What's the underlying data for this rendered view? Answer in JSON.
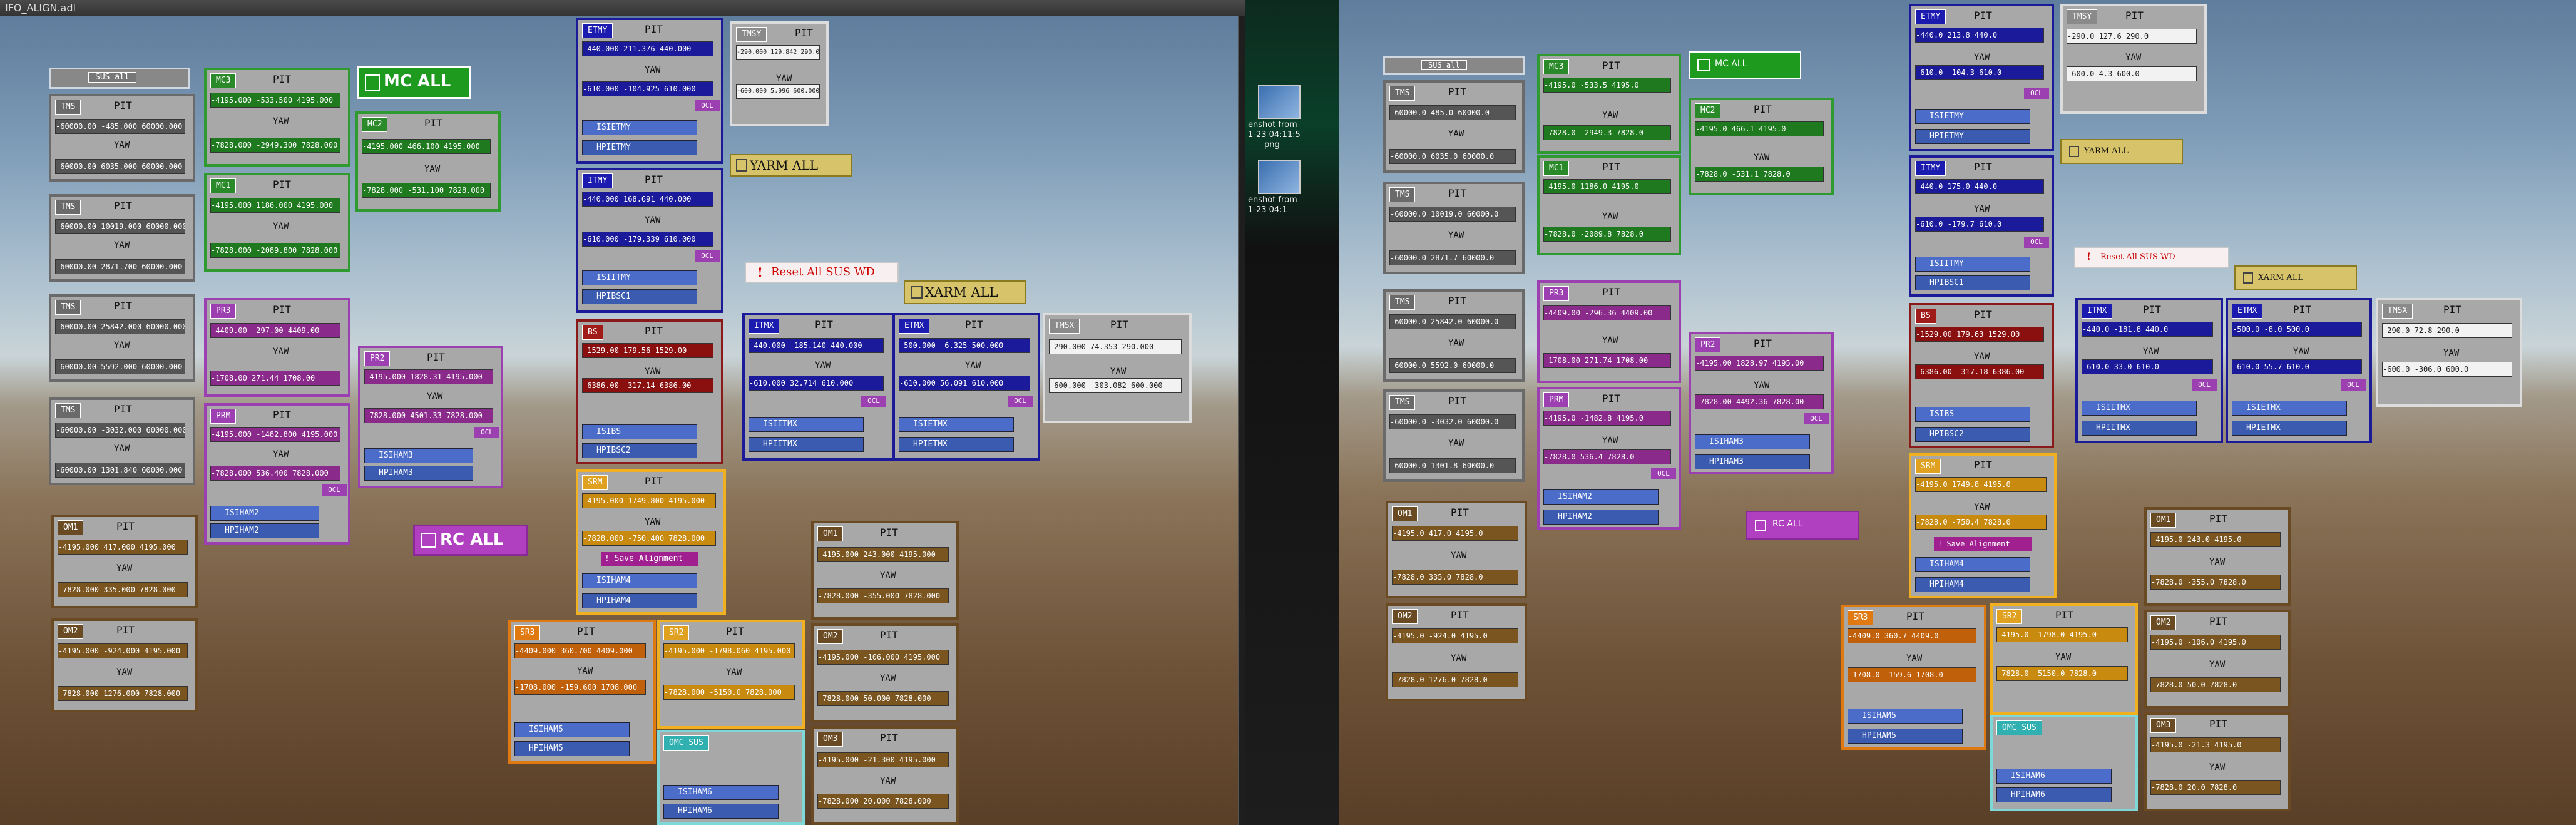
{
  "left": {
    "window_title": "IFO_ALIGN.adl",
    "sus_all": "SUS all",
    "mc_all": "MC ALL",
    "rc_all": "RC ALL",
    "yarm_all": "YARM ALL",
    "xarm_all": "XARM ALL",
    "reset_wd": "Reset All SUS WD",
    "save_alignment": "Save Alignment",
    "pit": "PIT",
    "yaw": "YAW",
    "panels": {
      "tms_top": {
        "tag": "TMS",
        "row1": "-60000.00 -485.000 60000.000",
        "row2": "-60000.00 6035.000 60000.000"
      },
      "tms_2": {
        "tag": "TMS",
        "row1": "-60000.00 10019.000 60000.000",
        "row2": "-60000.00 2871.700 60000.000"
      },
      "tms_3": {
        "tag": "TMS",
        "row1": "-60000.00 25842.000 60000.000",
        "row2": "-60000.00 5592.000 60000.000"
      },
      "tms_4": {
        "tag": "TMS",
        "row1": "-60000.00 -3032.000 60000.000",
        "row2": "-60000.00 1301.840 60000.000"
      },
      "om1": {
        "tag": "OM1",
        "row1": "-4195.000 417.000 4195.000",
        "row2": "-7828.000 335.000 7828.000"
      },
      "om2": {
        "tag": "OM2",
        "row1": "-4195.000 -924.000 4195.000",
        "row2": "-7828.000 1276.000 7828.000"
      },
      "mc3": {
        "tag": "MC3",
        "row1": "-4195.000 -533.500 4195.000",
        "row2": "-7828.000 -2949.300 7828.000"
      },
      "mc1": {
        "tag": "MC1",
        "row1": "-4195.000 1186.000 4195.000",
        "row2": "-7828.000 -2089.800 7828.000"
      },
      "mc2": {
        "tag": "MC2",
        "row1": "-4195.000 466.100 4195.000",
        "row2": "-7828.000 -531.100 7828.000"
      },
      "pr3": {
        "tag": "PR3",
        "row1": "-4409.00 -297.00 4409.00",
        "row2": "-1708.00 271.44 1708.00"
      },
      "prm": {
        "tag": "PRM",
        "row1": "-4195.000 -1482.800 4195.000",
        "row2": "-7828.000 536.400 7828.000"
      },
      "pr2": {
        "tag": "PR2",
        "row1": "-4195.000 1828.31 4195.000",
        "row2": "-7828.000 4501.33 7828.000"
      },
      "etmy": {
        "tag": "ETMY",
        "row1": "-440.000 211.376 440.000",
        "row2": "-610.000 -104.925 610.000"
      },
      "itmy": {
        "tag": "ITMY",
        "row1": "-440.000 168.691 440.000",
        "row2": "-610.000 -179.339 610.000"
      },
      "bs": {
        "tag": "BS",
        "row1": "-1529.00 179.56 1529.00",
        "row2": "-6386.00 -317.14 6386.00"
      },
      "tmsy": {
        "tag": "TMSY",
        "row1": "-290.000 129.842 290.000",
        "row2": "-600.000 5.996 600.000"
      },
      "itmx": {
        "tag": "ITMX",
        "row1": "-440.000 -185.140 440.000",
        "row2": "-610.000 32.714 610.000"
      },
      "etmx": {
        "tag": "ETMX",
        "row1": "-500.000 -6.325 500.000",
        "row2": "-610.000 56.091 610.000"
      },
      "tmsx": {
        "tag": "TMSX",
        "row1": "-290.000 74.353 290.000",
        "row2": "-600.000 -303.082 600.000"
      },
      "srm": {
        "tag": "SRM",
        "row1": "-4195.000 1749.800 4195.000",
        "row2": "-7828.000 -750.400 7828.000"
      },
      "sr3": {
        "tag": "SR3",
        "row1": "-4409.000 360.700 4409.000",
        "row2": "-1708.000 -159.600 1708.000"
      },
      "sr2": {
        "tag": "SR2",
        "row1": "-4195.000 -1798.060 4195.000",
        "row2": "-7828.000 -5150.0 7828.000"
      },
      "om1r": {
        "tag": "OM1",
        "row1": "-4195.000 243.000 4195.000",
        "row2": "-7828.000 -355.000 7828.000"
      },
      "om2r": {
        "tag": "OM2",
        "row1": "-4195.000 -106.000 4195.000",
        "row2": "-7828.000 50.000 7828.000"
      },
      "om3": {
        "tag": "OM3",
        "row1": "-4195.000 -21.300 4195.000",
        "row2": "-7828.000 20.000 7828.000"
      },
      "omc_sus": {
        "tag": "OMC SUS"
      }
    },
    "buttons": {
      "isi_etmy": "ISIETMY",
      "hpi_etmy": "HPIETMY",
      "isi_itmy": "ISIITMY",
      "hpi_bsc1": "HPIBSC1",
      "isi_bs": "ISIBS",
      "hpi_bsc2": "HPIBSC2",
      "isi_itmx": "ISIITMX",
      "hpi_itmx": "HPIITMX",
      "isi_etmx": "ISIETMX",
      "hpi_etmx": "HPIETMX",
      "isi_ham2": "ISIHAM2",
      "hpi_ham2": "HPIHAM2",
      "isi_ham3": "ISIHAM3",
      "hpi_ham3": "HPIHAM3",
      "isi_ham4": "ISIHAM4",
      "hpi_ham4": "HPIHAM4",
      "isi_ham5": "ISIHAM5",
      "hpi_ham5": "HPIHAM5",
      "isi_ham6": "ISIHAM6",
      "hpi_ham6": "HPIHAM6",
      "ocl": "OCL"
    }
  },
  "middle": {
    "icon1_label": "enshot from",
    "icon1_sub": "1-23 04:11:5",
    "icon1_ext": "png",
    "icon2_label": "enshot from",
    "icon2_sub": "1-23 04:1"
  },
  "right": {
    "sus_all": "SUS all",
    "mc_all": "MC ALL",
    "rc_all": "RC ALL",
    "yarm_all": "YARM ALL",
    "xarm_all": "XARM ALL",
    "reset_wd": "Reset All SUS WD",
    "save_alignment": "Save Alignment",
    "pit": "PIT",
    "yaw": "YAW",
    "panels": {
      "tms1": {
        "tag": "TMS",
        "row1": "-60000.0 485.0 60000.0",
        "row2": "-60000.0 6035.0 60000.0"
      },
      "tms2": {
        "tag": "TMS",
        "row1": "-60000.0 10019.0 60000.0",
        "row2": "-60000.0 2871.7 60000.0"
      },
      "tms3": {
        "tag": "TMS",
        "row1": "-60000.0 25842.0 60000.0",
        "row2": "-60000.0 5592.0 60000.0"
      },
      "tms4": {
        "tag": "TMS",
        "row1": "-60000.0 -3032.0 60000.0",
        "row2": "-60000.0 1301.8 60000.0"
      },
      "om1": {
        "tag": "OM1",
        "row1": "-4195.0 417.0 4195.0",
        "row2": "-7828.0 335.0 7828.0"
      },
      "om2": {
        "tag": "OM2",
        "row1": "-4195.0 -924.0 4195.0",
        "row2": "-7828.0 1276.0 7828.0"
      },
      "mc3": {
        "tag": "MC3",
        "row1": "-4195.0 -533.5 4195.0",
        "row2": "-7828.0 -2949.3 7828.0"
      },
      "mc1": {
        "tag": "MC1",
        "row1": "-4195.0 1186.0 4195.0",
        "row2": "-7828.0 -2089.8 7828.0"
      },
      "mc2": {
        "tag": "MC2",
        "row1": "-4195.0 466.1 4195.0",
        "row2": "-7828.0 -531.1 7828.0"
      },
      "pr3": {
        "tag": "PR3",
        "row1": "-4409.00 -296.36 4409.00",
        "row2": "-1708.00 271.74 1708.00"
      },
      "prm": {
        "tag": "PRM",
        "row1": "-4195.0 -1482.8 4195.0",
        "row2": "-7828.0 536.4 7828.0"
      },
      "pr2": {
        "tag": "PR2",
        "row1": "-4195.00 1828.97 4195.00",
        "row2": "-7828.00 4492.36 7828.00"
      },
      "etmy": {
        "tag": "ETMY",
        "row1": "-440.0 213.8 440.0",
        "row2": "-610.0 -104.3 610.0"
      },
      "itmy": {
        "tag": "ITMY",
        "row1": "-440.0 175.0 440.0",
        "row2": "-610.0 -179.7 610.0"
      },
      "bs": {
        "tag": "BS",
        "row1": "-1529.00 179.63 1529.00",
        "row2": "-6386.00 -317.18 6386.00"
      },
      "tmsy": {
        "tag": "TMSY",
        "row1": "-290.0 127.6 290.0",
        "row2": "-600.0 4.3 600.0"
      },
      "itmx": {
        "tag": "ITMX",
        "row1": "-440.0 -181.8 440.0",
        "row2": "-610.0 33.0 610.0"
      },
      "etmx": {
        "tag": "ETMX",
        "row1": "-500.0 -8.0 500.0",
        "row2": "-610.0 55.7 610.0"
      },
      "tmsx": {
        "tag": "TMSX",
        "row1": "-290.0 72.8 290.0",
        "row2": "-600.0 -306.0 600.0"
      },
      "srm": {
        "tag": "SRM",
        "row1": "-4195.0 1749.8 4195.0",
        "row2": "-7828.0 -750.4 7828.0"
      },
      "sr3": {
        "tag": "SR3",
        "row1": "-4409.0 360.7 4409.0",
        "row2": "-1708.0 -159.6 1708.0"
      },
      "sr2": {
        "tag": "SR2",
        "row1": "-4195.0 -1798.0 4195.0",
        "row2": "-7828.0 -5150.0 7828.0"
      },
      "om1r": {
        "tag": "OM1",
        "row1": "-4195.0 243.0 4195.0",
        "row2": "-7828.0 -355.0 7828.0"
      },
      "om2r": {
        "tag": "OM2",
        "row1": "-4195.0 -106.0 4195.0",
        "row2": "-7828.0 50.0 7828.0"
      },
      "om3": {
        "tag": "OM3",
        "row1": "-4195.0 -21.3 4195.0",
        "row2": "-7828.0 20.0 7828.0"
      },
      "omc_sus": {
        "tag": "OMC SUS"
      }
    },
    "buttons": {
      "isi_etmy": "ISIETMY",
      "hpi_etmy": "HPIETMY",
      "isi_itmy": "ISIITMY",
      "hpi_bsc1": "HPIBSC1",
      "isi_bs": "ISIBS",
      "hpi_bsc2": "HPIBSC2",
      "isi_itmx": "ISIITMX",
      "hpi_itmx": "HPIITMX",
      "isi_etmx": "ISIETMX",
      "hpi_etmx": "HPIETMX",
      "isi_ham2": "ISIHAM2",
      "hpi_ham2": "HPIHAM2",
      "isi_ham3": "ISIHAM3",
      "hpi_ham3": "HPIHAM3",
      "isi_ham4": "ISIHAM4",
      "hpi_ham4": "HPIHAM4",
      "isi_ham5": "ISIHAM5",
      "hpi_ham5": "HPIHAM5",
      "isi_ham6": "ISIHAM6",
      "hpi_ham6": "HPIHAM6",
      "ocl": "OCL"
    }
  }
}
